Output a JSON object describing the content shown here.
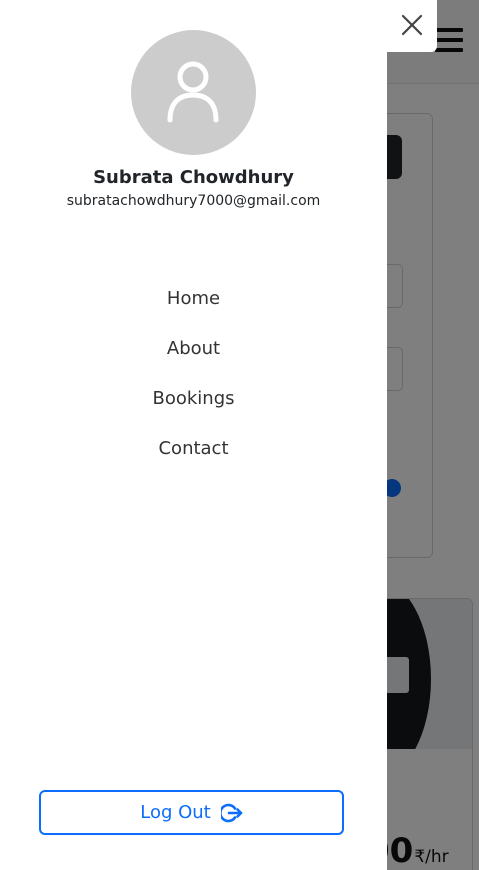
{
  "user": {
    "name": "Subrata Chowdhury",
    "email": "subratachowdhury7000@gmail.com"
  },
  "nav": {
    "items": [
      {
        "label": "Home"
      },
      {
        "label": "About"
      },
      {
        "label": "Bookings"
      },
      {
        "label": "Contact"
      }
    ]
  },
  "logout": {
    "label": "Log Out",
    "icon": "logout-icon"
  },
  "background": {
    "price_value": "00",
    "price_unit": "₹/hr"
  },
  "icons": {
    "close": "close-icon",
    "menu": "hamburger-icon",
    "avatar": "user-avatar-icon"
  },
  "colors": {
    "accent": "#0d6efd",
    "avatar_bg": "#cccccc",
    "overlay": "rgba(0,0,0,0.5)"
  }
}
